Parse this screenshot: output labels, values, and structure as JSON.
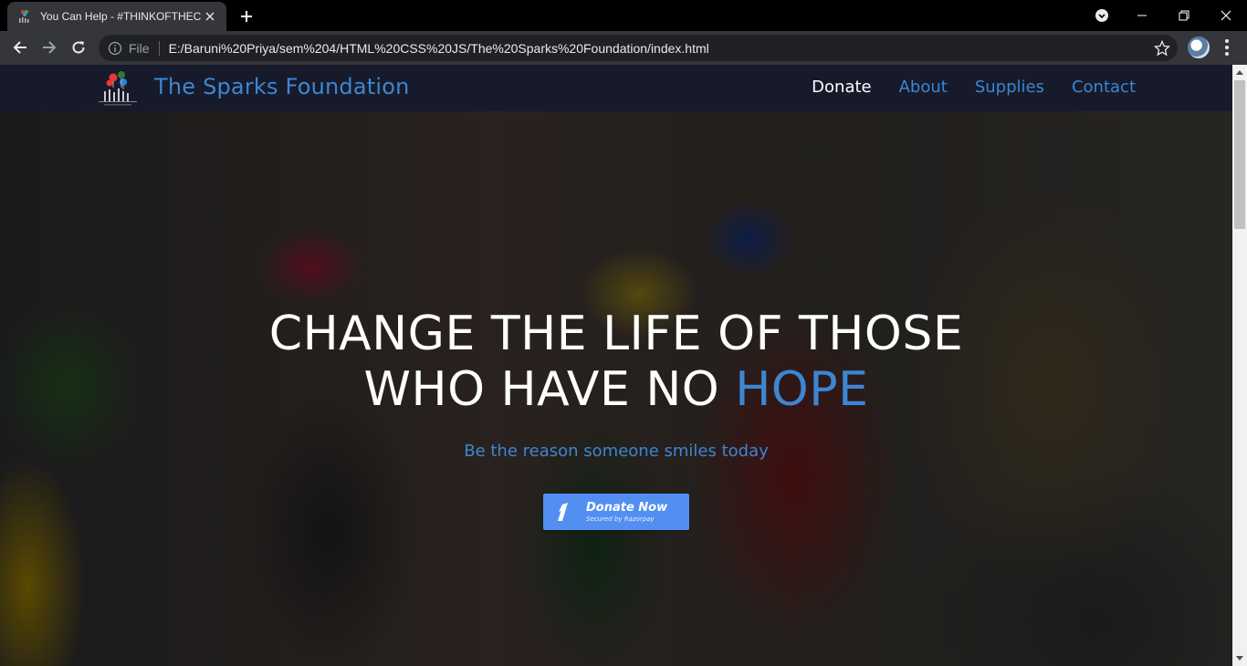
{
  "browser": {
    "tab": {
      "title": "You Can Help - #THINKOFTHECH",
      "favicon": "sparks-logo-icon"
    },
    "newtab_icon": "plus-icon",
    "window_controls": [
      "minimize-icon",
      "restore-icon",
      "close-icon"
    ],
    "nav_icons": [
      "back-arrow-icon",
      "forward-arrow-icon",
      "reload-icon"
    ],
    "omnibox": {
      "scheme": "File",
      "url": "E:/Baruni%20Priya/sem%204/HTML%20CSS%20JS/The%20Sparks%20Foundation/index.html"
    }
  },
  "page": {
    "navbar": {
      "brand": "The Sparks Foundation",
      "links": [
        "Donate",
        "About",
        "Supplies",
        "Contact"
      ],
      "active_link": "Donate"
    },
    "hero": {
      "headline_line1": "CHANGE THE LIFE OF THOSE",
      "headline_line2": "WHO HAVE NO ",
      "headline_highlight": "HOPE",
      "subtitle": "Be the reason someone smiles today",
      "donate_button": {
        "label": "Donate Now",
        "sublabel": "Secured by Razorpay"
      }
    }
  },
  "colors": {
    "accent": "#3d86d1",
    "navbar_bg": "#161a2a",
    "button_bg": "#528ff0"
  }
}
